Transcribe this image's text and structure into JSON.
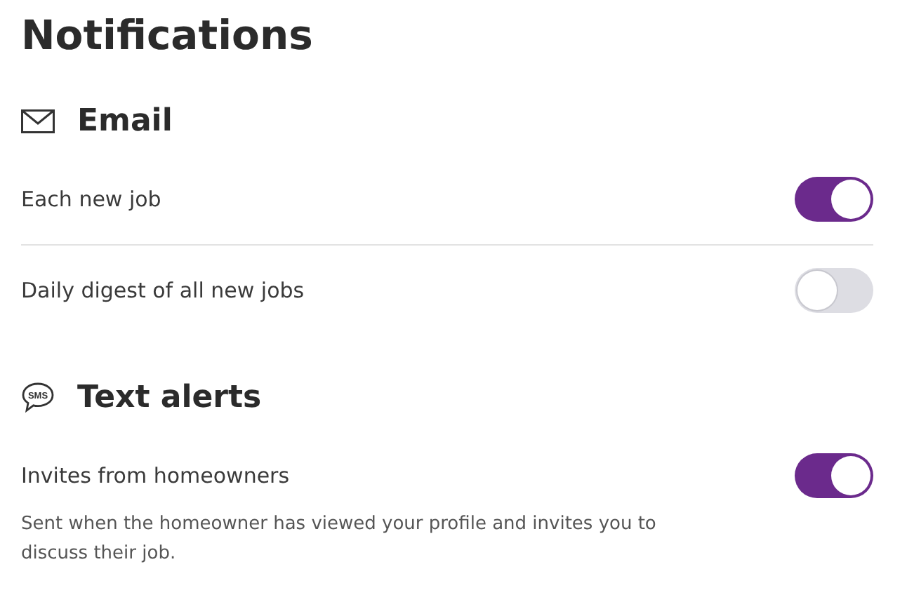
{
  "title": "Notifications",
  "sections": [
    {
      "kind": "email",
      "heading": "Email",
      "rows": [
        {
          "label": "Each new job",
          "on": true
        },
        {
          "label": "Daily digest of all new jobs",
          "on": false
        }
      ]
    },
    {
      "kind": "sms",
      "icon_text": "SMS",
      "heading": "Text alerts",
      "rows": [
        {
          "label": "Invites from homeowners",
          "on": true,
          "description": "Sent when the homeowner has viewed your profile and invites you to discuss their job."
        }
      ]
    }
  ]
}
